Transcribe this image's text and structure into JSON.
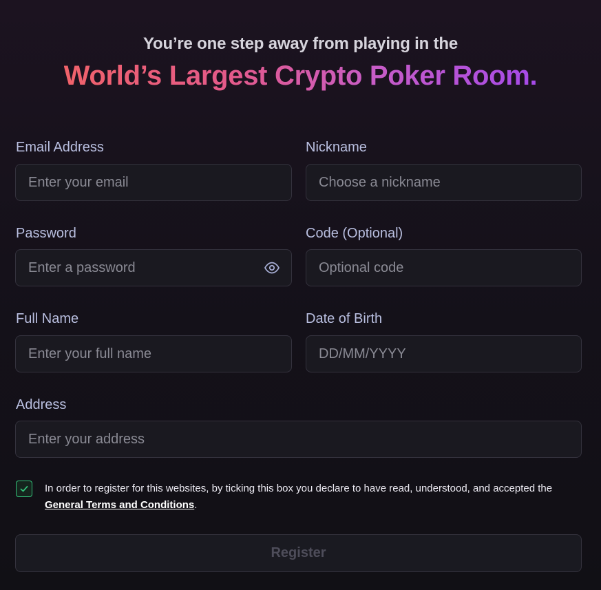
{
  "header": {
    "subtitle": "You’re one step away from playing in the",
    "title": "World’s Largest Crypto Poker Room."
  },
  "form": {
    "email": {
      "label": "Email Address",
      "placeholder": "Enter your email",
      "value": ""
    },
    "nickname": {
      "label": "Nickname",
      "placeholder": "Choose a nickname",
      "value": ""
    },
    "password": {
      "label": "Password",
      "placeholder": "Enter a password",
      "value": "",
      "icon": "eye-icon"
    },
    "code": {
      "label": "Code (Optional)",
      "placeholder": "Optional code",
      "value": ""
    },
    "full_name": {
      "label": "Full Name",
      "placeholder": "Enter your full name",
      "value": ""
    },
    "dob": {
      "label": "Date of Birth",
      "placeholder": "DD/MM/YYYY",
      "value": ""
    },
    "address": {
      "label": "Address",
      "placeholder": "Enter your address",
      "value": ""
    }
  },
  "consent": {
    "checked": true,
    "text": "In order to register for this websites, by ticking this box you declare to have read, understood, and accepted the ",
    "link": "General Terms and Conditions",
    "suffix": "."
  },
  "register_button": {
    "label": "Register",
    "enabled": false
  },
  "colors": {
    "accent_start": "#f0626a",
    "accent_end": "#a54ae8",
    "check_green": "#33c27a",
    "label": "#b9bfe0"
  }
}
